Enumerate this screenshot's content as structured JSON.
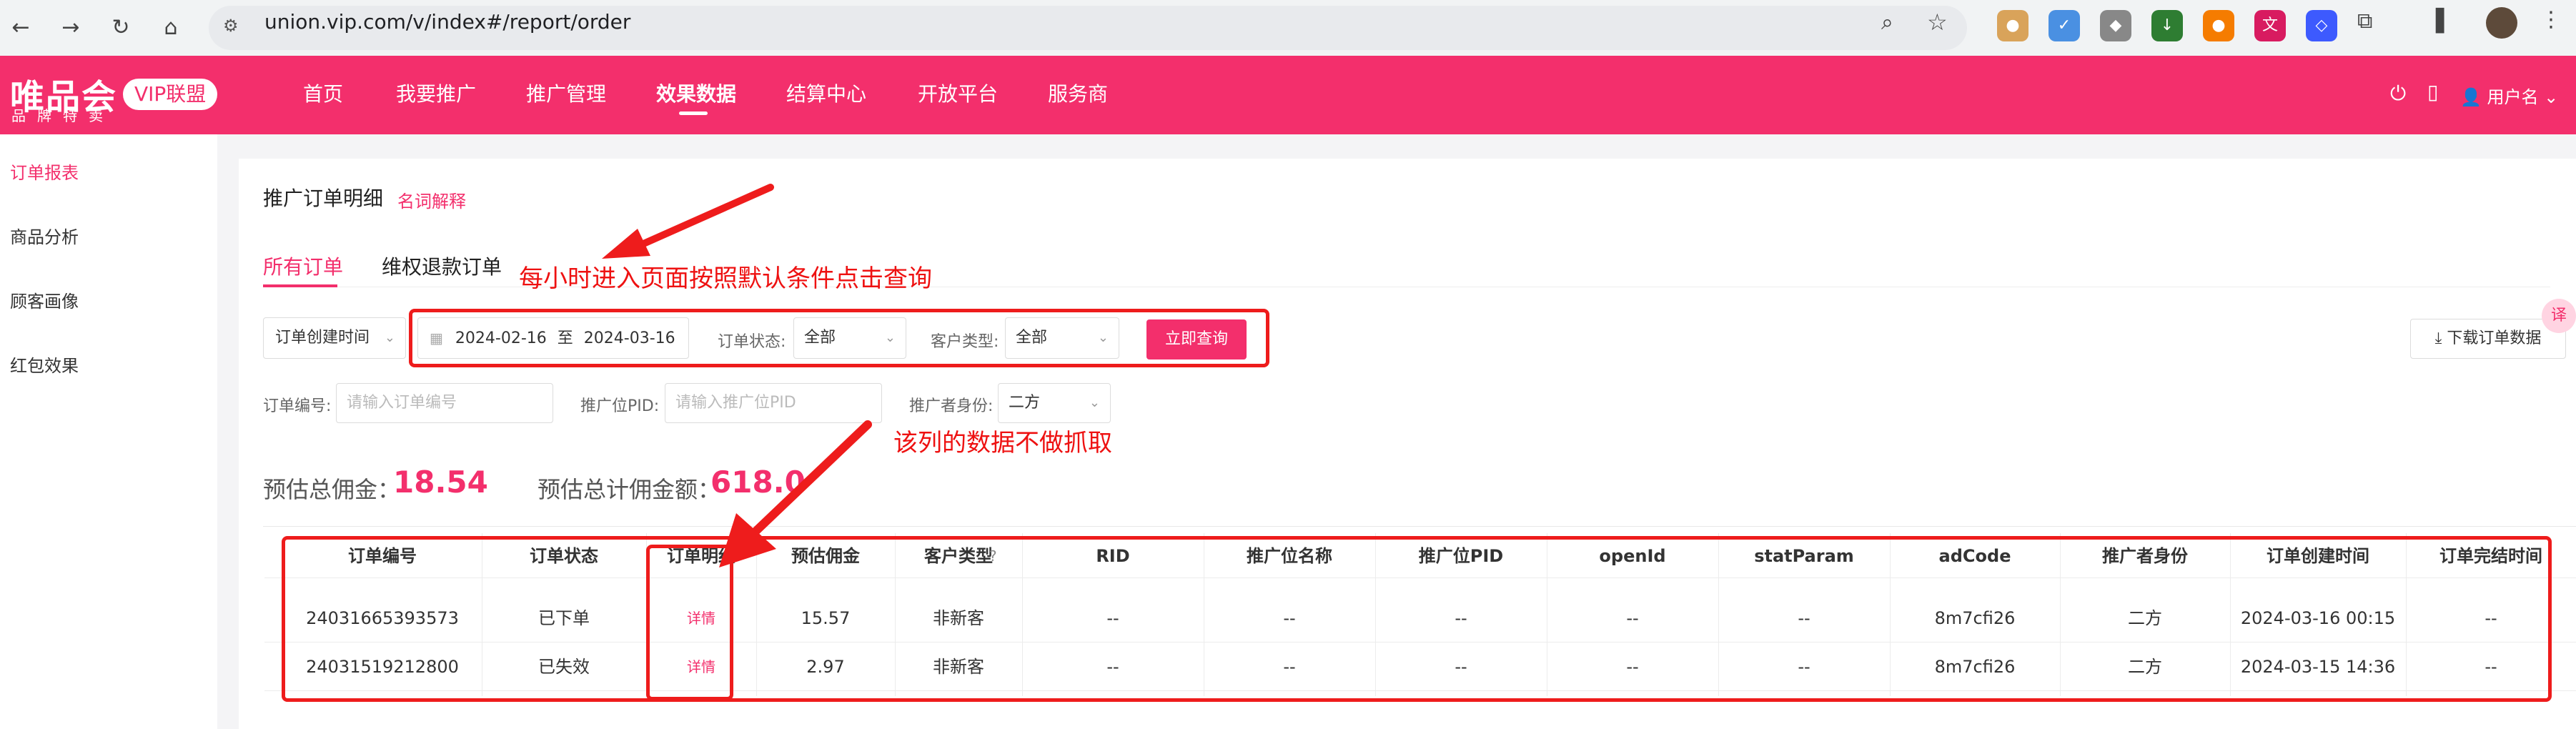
{
  "browser": {
    "url": "union.vip.com/v/index#/report/order",
    "back_icon": "←",
    "forward_icon": "→",
    "reload_icon": "↻",
    "home_icon": "⌂"
  },
  "header": {
    "logo_main": "唯品会",
    "logo_sub": "品牌特卖",
    "badge": "VIP联盟",
    "nav": [
      "首页",
      "我要推广",
      "推广管理",
      "效果数据",
      "结算中心",
      "开放平台",
      "服务商"
    ],
    "active_nav_index": 3,
    "user_label": "用户名"
  },
  "sidebar": {
    "items": [
      "订单报表",
      "商品分析",
      "顾客画像",
      "红包效果"
    ],
    "active_index": 0
  },
  "main": {
    "title": "推广订单明细",
    "glossary_link": "名词解释",
    "tabs": [
      "所有订单",
      "维权退款订单"
    ],
    "filters": {
      "time_type": "订单创建时间",
      "date_start": "2024-02-16",
      "date_sep": "至",
      "date_end": "2024-03-16",
      "status_label": "订单状态:",
      "status_value": "全部",
      "customer_label": "客户类型:",
      "customer_value": "全部",
      "query_button": "立即查询",
      "download_button": "下载订单数据",
      "order_no_label": "订单编号:",
      "order_no_placeholder": "请输入订单编号",
      "pid_label": "推广位PID:",
      "pid_placeholder": "请输入推广位PID",
      "promoter_label": "推广者身份:",
      "promoter_value": "二方"
    },
    "totals": {
      "commission_label": "预估总佣金：",
      "commission_value": "18.54",
      "amount_label": "预估总计佣金额：",
      "amount_value": "618.0"
    },
    "table": {
      "columns": [
        "订单编号",
        "订单状态",
        "订单明细",
        "预估佣金",
        "客户类型",
        "RID",
        "推广位名称",
        "推广位PID",
        "openId",
        "statParam",
        "adCode",
        "推广者身份",
        "订单创建时间",
        "订单完结时间"
      ],
      "rows": [
        [
          "24031665393573",
          "已下单",
          "详情",
          "15.57",
          "非新客",
          "--",
          "--",
          "--",
          "--",
          "--",
          "8m7cfi26",
          "二方",
          "2024-03-16 00:15",
          "--"
        ],
        [
          "24031519212800",
          "已失效",
          "详情",
          "2.97",
          "非新客",
          "--",
          "--",
          "--",
          "--",
          "--",
          "8m7cfi26",
          "二方",
          "2024-03-15 14:36",
          "--"
        ]
      ]
    }
  },
  "annotations": {
    "note1": "每小时进入页面按照默认条件点击查询",
    "note2": "该列的数据不做抓取",
    "color": "#ee1c1c"
  },
  "colors": {
    "brand": "#f32f6c"
  }
}
